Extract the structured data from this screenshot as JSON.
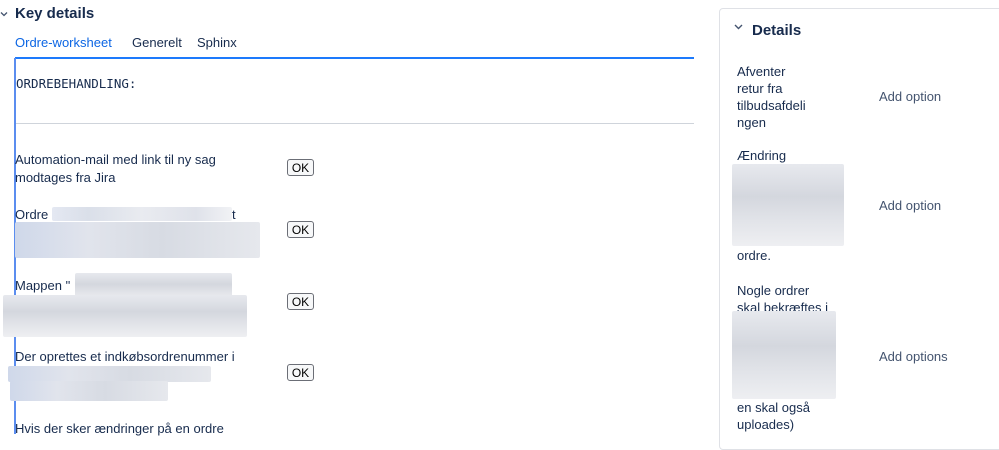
{
  "key_details": {
    "title": "Key details",
    "tabs": [
      {
        "label": "Ordre-worksheet",
        "active": true
      },
      {
        "label": "Generelt",
        "active": false
      },
      {
        "label": "Sphinx",
        "active": false
      }
    ],
    "section_heading": "ORDREBEHANDLING:",
    "rows": [
      {
        "line1": "Automation-mail med link til ny sag",
        "line2": "modtages fra Jira",
        "button": "OK"
      },
      {
        "line1": "Ordre",
        "line1_tail": "t",
        "button": "OK"
      },
      {
        "line1": "Mappen \"",
        "button": "OK"
      },
      {
        "line1": "Der oprettes et indkøbsordrenummer i",
        "button": "OK"
      },
      {
        "line1": "Hvis der sker ændringer på en ordre"
      }
    ]
  },
  "details_panel": {
    "title": "Details",
    "fields": [
      {
        "label_lines": [
          "Afventer",
          "retur fra",
          "tilbudsafdeli",
          "ngen"
        ],
        "action": "Add option"
      },
      {
        "label_lines": [
          "Ændring",
          "ordre."
        ],
        "action": "Add option"
      },
      {
        "label_lines": [
          "Nogle ordrer",
          "skal bekræftes i",
          "en skal også",
          "uploades)"
        ],
        "action": "Add options"
      }
    ]
  },
  "colors": {
    "accent": "#0c66e4",
    "text": "#172b4d",
    "muted": "#44546f"
  }
}
